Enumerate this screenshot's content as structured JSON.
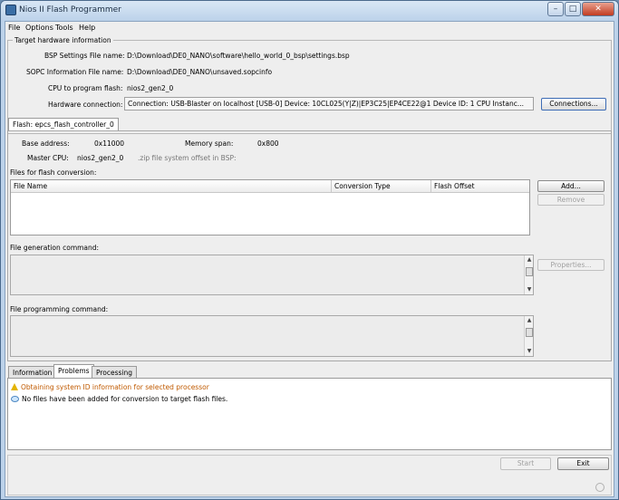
{
  "window": {
    "title": "Nios II Flash Programmer",
    "caption_buttons": {
      "minimize": "–",
      "maximize": "□",
      "close": "✕"
    }
  },
  "menu": [
    "File",
    "Options",
    "Tools",
    "Help"
  ],
  "target": {
    "group_title": "Target hardware information",
    "bsp_label": "BSP Settings File name:",
    "bsp_value": "D:\\Download\\DE0_NANO\\software\\hello_world_0_bsp\\settings.bsp",
    "sopc_label": "SOPC Information File name:",
    "sopc_value": "D:\\Download\\DE0_NANO\\unsaved.sopcinfo",
    "cpu_label": "CPU to program flash:",
    "cpu_value": "nios2_gen2_0",
    "hw_label": "Hardware connection:",
    "hw_value": "Connection: USB-Blaster on localhost [USB-0]    Device: 10CL025(Y|Z)|EP3C25|EP4CE22@1    Device ID: 1    CPU Instanc...",
    "connections_button": "Connections..."
  },
  "flash_tab": {
    "label": "Flash: epcs_flash_controller_0",
    "base_address_label": "Base address:",
    "base_address_value": "0x11000",
    "memory_span_label": "Memory span:",
    "memory_span_value": "0x800",
    "master_cpu_label": "Master CPU:",
    "master_cpu_value": "nios2_gen2_0",
    "zip_note": ".zip file system offset in BSP:",
    "files_label": "Files for flash conversion:",
    "columns": [
      "File Name",
      "Conversion Type",
      "Flash Offset"
    ],
    "add_button": "Add...",
    "remove_button": "Remove",
    "generation_label": "File generation command:",
    "properties_button": "Properties...",
    "programming_label": "File programming command:"
  },
  "bottom_tabs": [
    "Information",
    "Problems",
    "Processing"
  ],
  "messages": [
    {
      "type": "warning",
      "text": "Obtaining system ID information for selected processor",
      "color": "#c05a00"
    },
    {
      "type": "info",
      "text": "No files have been added for conversion to target flash files.",
      "color": "#000000"
    }
  ],
  "footer": {
    "start_button": "Start",
    "exit_button": "Exit"
  }
}
